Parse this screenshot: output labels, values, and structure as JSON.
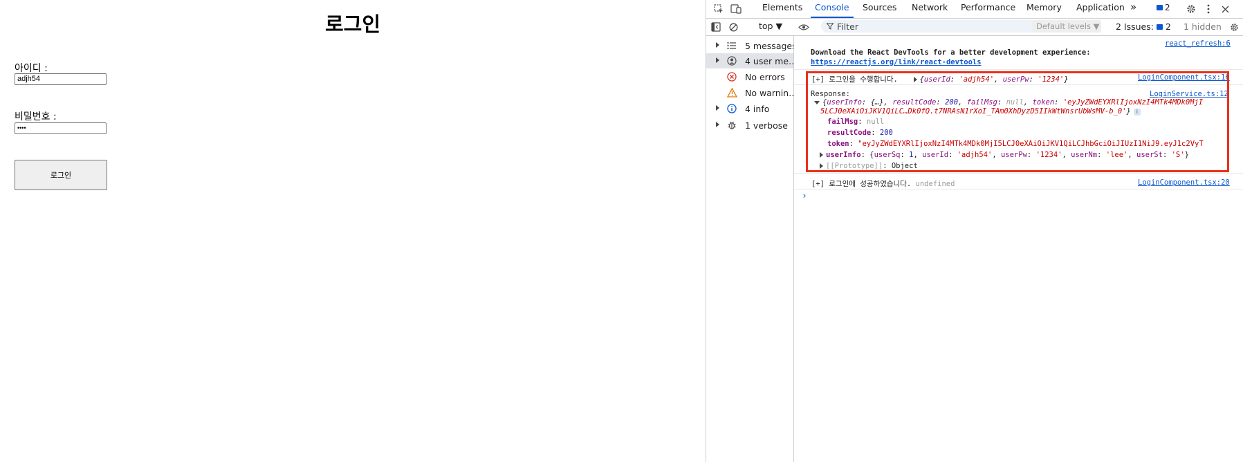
{
  "page": {
    "title": "로그인",
    "id_label": "아이디 :",
    "id_value": "adjh54",
    "pw_label": "비밀번호 :",
    "pw_value": "••••",
    "login_button": "로그인"
  },
  "devtools": {
    "tabs": [
      "Elements",
      "Console",
      "Sources",
      "Network",
      "Performance",
      "Memory",
      "Application"
    ],
    "active_tab": "Console",
    "more_tabs": "»",
    "issues_badge": "2",
    "toolbar": {
      "context": "top ▼",
      "filter_placeholder": "Filter",
      "levels": "Default levels ▼",
      "issues_label": "2 Issues:",
      "issues_count": "2",
      "hidden": "1 hidden"
    },
    "sidebar": [
      {
        "label": "5 messages",
        "icon": "list-icon"
      },
      {
        "label": "4 user me…",
        "icon": "user-icon"
      },
      {
        "label": "No errors",
        "icon": "error-icon"
      },
      {
        "label": "No warnin…",
        "icon": "warning-icon"
      },
      {
        "label": "4 info",
        "icon": "info-icon"
      },
      {
        "label": "1 verbose",
        "icon": "bug-icon"
      }
    ],
    "console": {
      "msg1_source": "react_refresh:6",
      "msg1_text": "Download the React DevTools for a better development experience:",
      "msg1_link": "https://reactjs.org/link/react-devtools",
      "msg2_text": "[+] 로그인을 수행합니다.",
      "msg2_obj_prefix": "{",
      "msg2_k1": "userId",
      "msg2_v1": "'adjh54'",
      "msg2_k2": "userPw",
      "msg2_v2": "'1234'",
      "msg2_source": "LoginComponent.tsx:16",
      "msg3_label": "Response:",
      "msg3_source": "LoginService.ts:12",
      "msg3_summary_k1": "userInfo",
      "msg3_summary_v1": "{…}",
      "msg3_summary_k2": "resultCode",
      "msg3_summary_v2": "200",
      "msg3_summary_k3": "failMsg",
      "msg3_summary_v3": "null",
      "msg3_summary_k4": "token",
      "msg3_summary_v4a": "'eyJyZWdEYXRlIjoxNzI4MTk4MDk0MjI",
      "msg3_summary_v4b": "5LCJ0eXAiOiJKV1QiLC…Dk0fQ.t7NRAsN1rXoI_TAm0XhDyzD5IIkWtWnsrUbWsMV-b_0'",
      "failMsg_key": "failMsg",
      "failMsg_val": "null",
      "resultCode_key": "resultCode",
      "resultCode_val": "200",
      "token_key": "token",
      "token_val": "\"eyJyZWdEYXRlIjoxNzI4MTk4MDk0MjI5LCJ0eXAiOiJKV1QiLCJhbGciOiJIUzI1NiJ9.eyJ1c2VyT",
      "userInfo_key": "userInfo",
      "userInfo_val_open": "{",
      "ui_k1": "userSq",
      "ui_v1": "1",
      "ui_k2": "userId",
      "ui_v2": "'adjh54'",
      "ui_k3": "userPw",
      "ui_v3": "'1234'",
      "ui_k4": "userNm",
      "ui_v4": "'lee'",
      "ui_k5": "userSt",
      "ui_v5": "'S'",
      "proto_key": "[[Prototype]]",
      "proto_val": "Object",
      "msg4_text": "[+] 로그인에 성공하였습니다.",
      "msg4_val": "undefined",
      "msg4_source": "LoginComponent.tsx:20",
      "prompt": "›"
    }
  }
}
